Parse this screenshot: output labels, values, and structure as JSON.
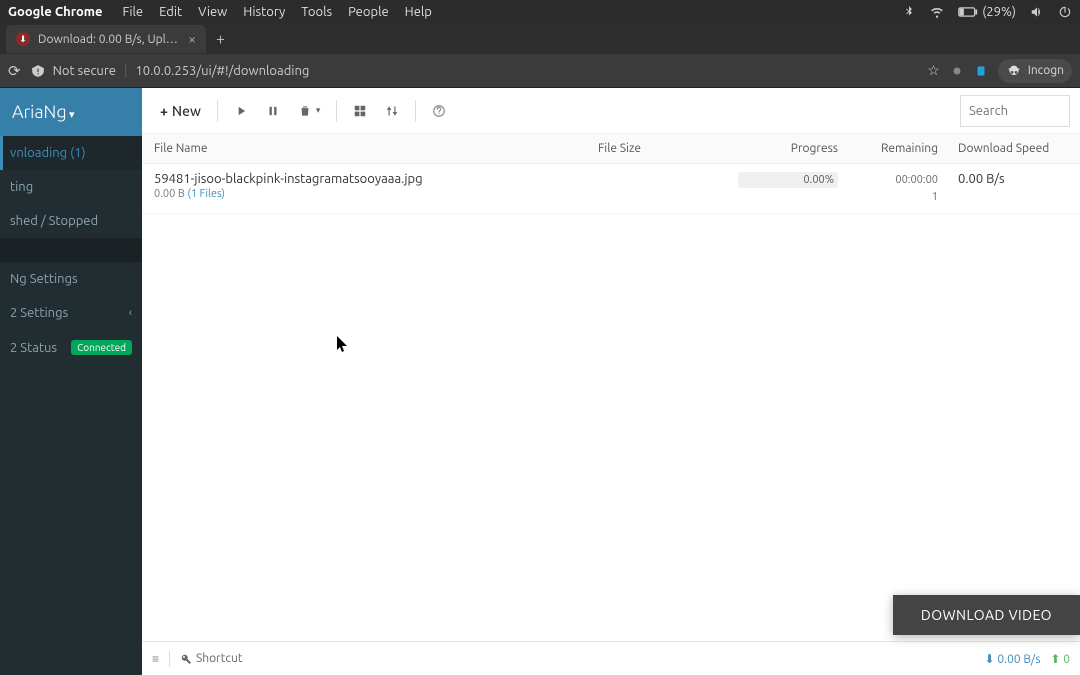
{
  "os": {
    "app_name": "Google Chrome",
    "menus": [
      "File",
      "Edit",
      "View",
      "History",
      "Tools",
      "People",
      "Help"
    ],
    "battery": "(29%)"
  },
  "browser": {
    "tab_title": "Download: 0.00 B/s, Uplo…",
    "not_secure": "Not secure",
    "url": "10.0.0.253/ui/#!/downloading",
    "incognito": "Incogn"
  },
  "app": {
    "brand": "AriaNg",
    "sidebar": {
      "downloading": "vnloading (1)",
      "waiting": "ting",
      "finished": "shed / Stopped",
      "settings": "Ng Settings",
      "aria2settings": "2 Settings",
      "aria2status": "2 Status",
      "connected": "Connected"
    },
    "toolbar": {
      "new": "New",
      "search_ph": "Search"
    },
    "columns": {
      "name": "File Name",
      "size": "File Size",
      "progress": "Progress",
      "remaining": "Remaining",
      "speed": "Download Speed"
    },
    "rows": [
      {
        "name": "59481-jisoo-blackpink-instagramatsooyaaa.jpg",
        "meta_bytes": "0.00 B",
        "meta_files": "(1 Files)",
        "progress": "0.00%",
        "remaining_time": "00:00:00",
        "remaining_conn": "1",
        "speed": "0.00 B/s"
      }
    ],
    "footer": {
      "shortcut": "Shortcut",
      "down": "0.00 B/s",
      "up": "0"
    },
    "overlay": "DOWNLOAD VIDEO"
  }
}
